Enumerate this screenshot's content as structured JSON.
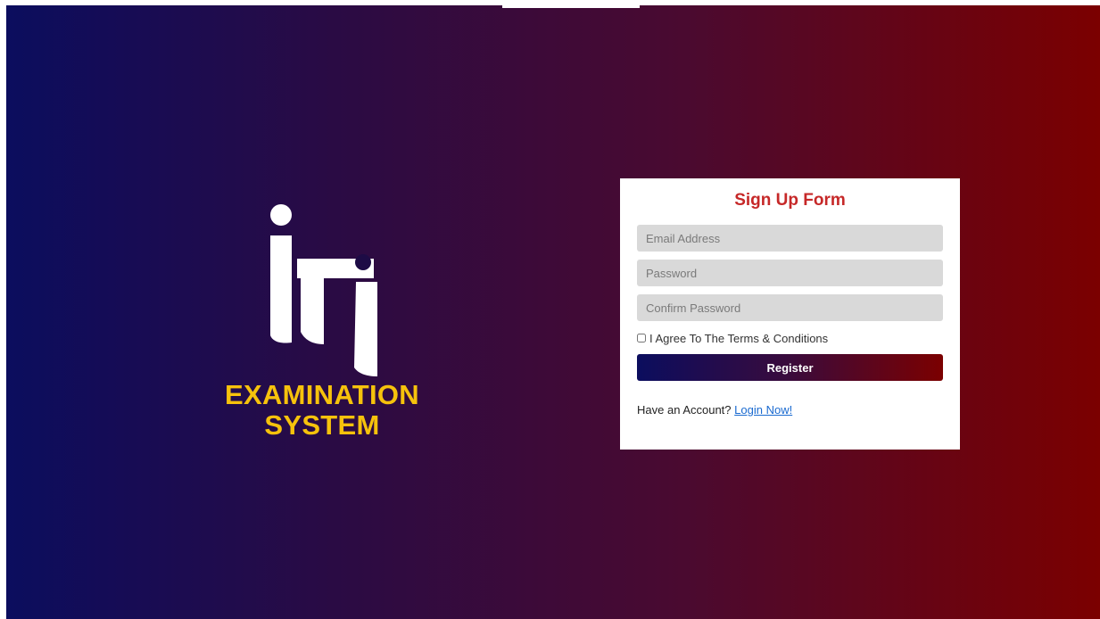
{
  "logo": {
    "line1": "EXAMINATION",
    "line2": "SYSTEM",
    "mark_color": "#ffffff",
    "text_color": "#f6c20c"
  },
  "form": {
    "title": "Sign Up Form",
    "email_placeholder": "Email Address",
    "password_placeholder": "Password",
    "confirm_placeholder": "Confirm Password",
    "agree_label": "I Agree To The Terms & Conditions",
    "register_label": "Register",
    "have_account_text": "Have an Account?",
    "login_link": "Login Now!"
  },
  "colors": {
    "gradient_start": "#0b0d5e",
    "gradient_end": "#7b0000",
    "title": "#c62828",
    "link": "#1a6ad0"
  }
}
